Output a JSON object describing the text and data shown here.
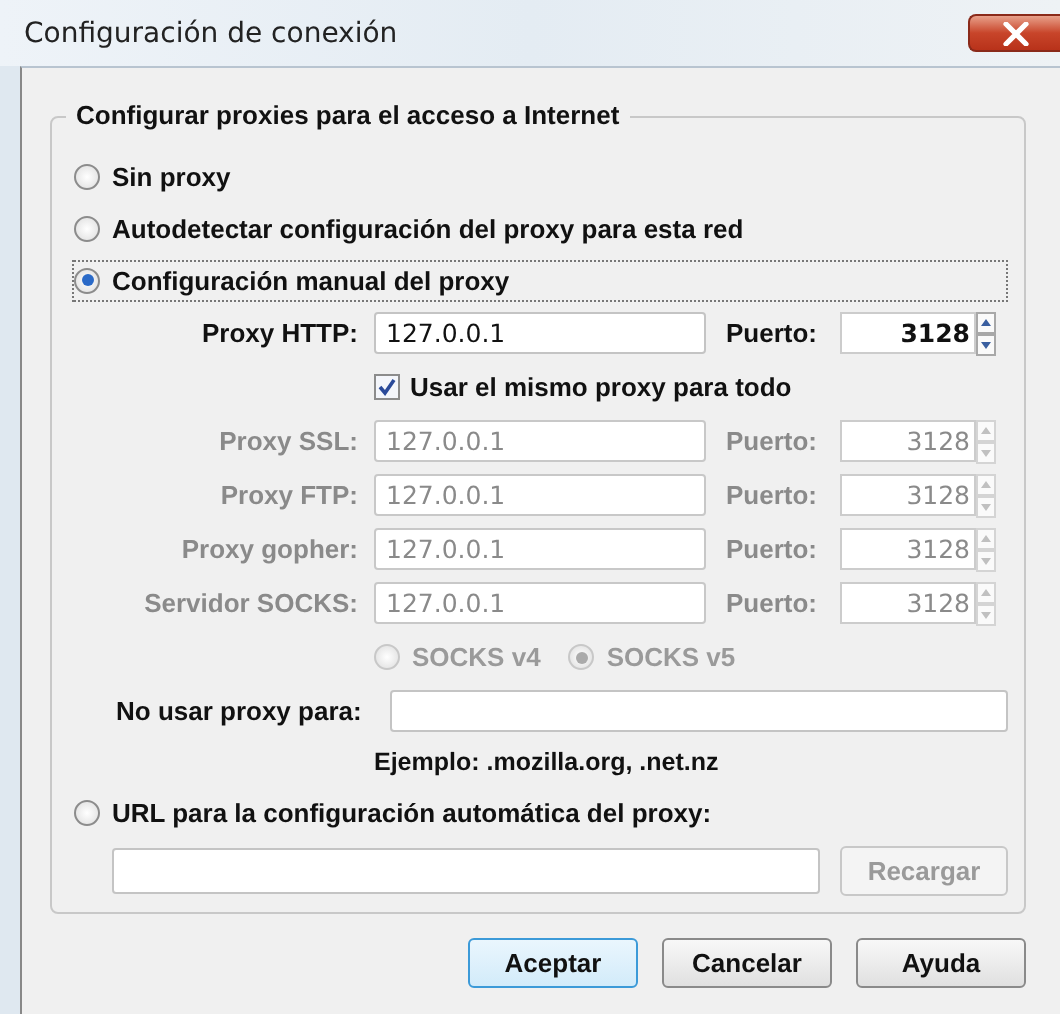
{
  "window": {
    "title": "Configuración de conexión"
  },
  "group": {
    "title": "Configurar proxies para el acceso a Internet"
  },
  "modes": [
    {
      "label": "Sin proxy",
      "selected": false,
      "focused": false
    },
    {
      "label": "Autodetectar configuración del proxy para esta red",
      "selected": false,
      "focused": false
    },
    {
      "label": "Configuración manual del proxy",
      "selected": true,
      "focused": true
    },
    {
      "label": "URL para la configuración automática del proxy:",
      "selected": false,
      "focused": false
    }
  ],
  "proxies": [
    {
      "label": "Proxy HTTP:",
      "value": "127.0.0.1",
      "port_label": "Puerto:",
      "port": "3128",
      "disabled": false
    },
    {
      "label": "Proxy SSL:",
      "value": "127.0.0.1",
      "port_label": "Puerto:",
      "port": "3128",
      "disabled": true
    },
    {
      "label": "Proxy FTP:",
      "value": "127.0.0.1",
      "port_label": "Puerto:",
      "port": "3128",
      "disabled": true
    },
    {
      "label": "Proxy gopher:",
      "value": "127.0.0.1",
      "port_label": "Puerto:",
      "port": "3128",
      "disabled": true
    },
    {
      "label": "Servidor SOCKS:",
      "value": "127.0.0.1",
      "port_label": "Puerto:",
      "port": "3128",
      "disabled": true
    }
  ],
  "same_proxy": {
    "label": "Usar el mismo proxy para todo",
    "checked": true
  },
  "socks_versions": [
    {
      "label": "SOCKS v4",
      "selected": false,
      "disabled": true
    },
    {
      "label": "SOCKS v5",
      "selected": true,
      "disabled": true
    }
  ],
  "no_proxy": {
    "label": "No usar proxy para:"
  },
  "example": "Ejemplo: .mozilla.org, .net.nz",
  "reload_button": {
    "label": "Recargar",
    "disabled": true
  },
  "buttons": [
    {
      "label": "Aceptar",
      "default": true
    },
    {
      "label": "Cancelar",
      "default": false
    },
    {
      "label": "Ayuda",
      "default": false
    }
  ]
}
